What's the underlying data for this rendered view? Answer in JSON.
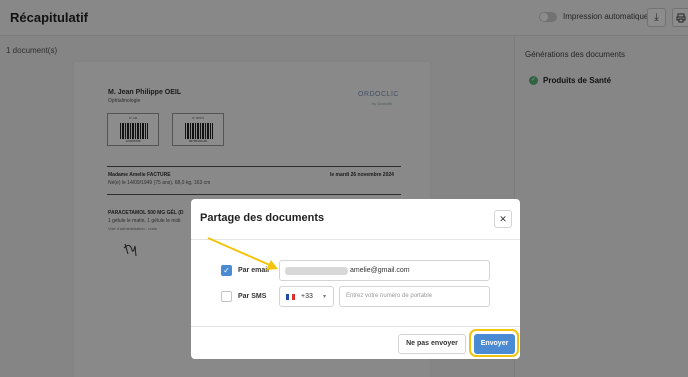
{
  "header": {
    "title": "Récapitulatif",
    "auto_print_label": "Impression automatique",
    "download_icon": "download-icon",
    "print_icon": "printer-icon"
  },
  "left": {
    "doc_count": "1 document(s)"
  },
  "prescription": {
    "doctor_name": "M. Jean Philippe OEIL",
    "specialty": "Ophtalmologie",
    "logo": "ORDOCLIC",
    "logo_sub": "by Doctolib",
    "barcode1_top": "N° AM",
    "barcode1_num": "123456789",
    "barcode2_top": "N° RPPS",
    "barcode2_num": "98765432100",
    "patient": "Madame Amelie FACTURE",
    "date": "le mardi 26 novembre 2024",
    "patient_info": "Né(e) le 14/09/1949 (75 ans), 68,0 kg, 163 cm",
    "drug": "PARACETAMOL 500 MG GÉL (D",
    "posology": "1 gélule le matin, 1 gélule le midi",
    "route": "Voie d'administration : orale"
  },
  "right_panel": {
    "title": "Générations des documents",
    "item": "Produits de Santé"
  },
  "modal": {
    "title": "Partage des documents",
    "close_symbol": "✕",
    "email_label": "Par email",
    "email_value": "amelie@gmail.com",
    "sms_label": "Par SMS",
    "phone_prefix": "+33",
    "phone_placeholder": "Entrez votre numéro de portable",
    "cancel_label": "Ne pas envoyer",
    "send_label": "Envoyer"
  },
  "colors": {
    "accent": "#4a8bd4",
    "highlight": "#f2c40e",
    "success": "#5ab57a"
  }
}
